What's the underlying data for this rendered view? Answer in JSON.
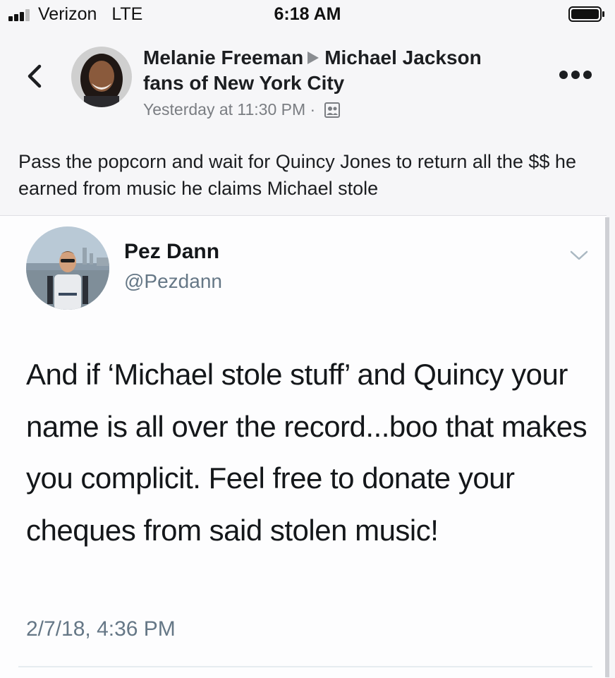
{
  "status_bar": {
    "carrier": "Verizon",
    "network": "LTE",
    "time": "6:18 AM",
    "battery_level": 1.0
  },
  "post": {
    "author": "Melanie Freeman",
    "group_part1": "Michael Jackson",
    "group_part2": "fans of New York City",
    "timestamp": "Yesterday at 11:30 PM",
    "separator": "·",
    "privacy_icon": "group-icon",
    "text": "Pass the popcorn and wait for Quincy Jones to return all the $$ he earned from music he claims Michael stole"
  },
  "tweet": {
    "name": "Pez Dann",
    "handle": "@Pezdann",
    "text": "And if ‘Michael stole stuff’ and Quincy your name is all over the record...boo that makes you complicit. Feel free to donate your cheques from said stolen music!",
    "timestamp": "2/7/18, 4:36 PM"
  },
  "icons": {
    "back": "chevron-left-icon",
    "more": "more-horizontal-icon",
    "tweet_menu": "chevron-down-icon"
  },
  "colors": {
    "background": "#f6f6f8",
    "text": "#1c1e21",
    "meta": "#7a7d82",
    "tweet_secondary": "#657786"
  }
}
